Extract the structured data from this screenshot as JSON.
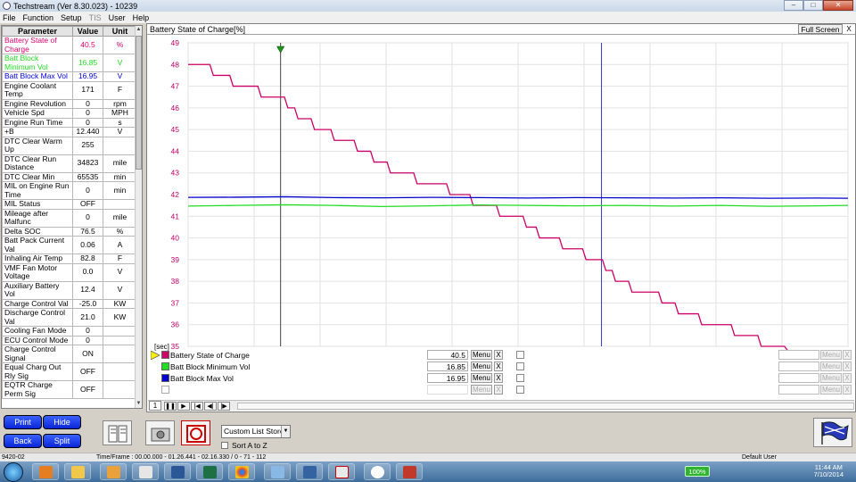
{
  "window": {
    "title": "Techstream (Ver 8.30.023) - 10239"
  },
  "menu": {
    "items": [
      "File",
      "Function",
      "Setup",
      "TIS",
      "User",
      "Help"
    ]
  },
  "params": {
    "headers": [
      "Parameter",
      "Value",
      "Unit"
    ],
    "rows": [
      {
        "name": "Battery State of Charge",
        "value": "40.5",
        "unit": "%",
        "color": "#e0006e",
        "h": 19
      },
      {
        "name": "Batt Block Minimum Vol",
        "value": "16.85",
        "unit": "V",
        "color": "#22dd22",
        "h": 19
      },
      {
        "name": "Batt Block Max Vol",
        "value": "16.95",
        "unit": "V",
        "color": "#0000dd",
        "h": 10
      },
      {
        "name": "Engine Coolant Temp",
        "value": "171",
        "unit": "F",
        "color": "#000",
        "h": 19
      },
      {
        "name": "Engine Revolution",
        "value": "0",
        "unit": "rpm",
        "color": "#000",
        "h": 10
      },
      {
        "name": "Vehicle Spd",
        "value": "0",
        "unit": "MPH",
        "color": "#000",
        "h": 10
      },
      {
        "name": "Engine Run Time",
        "value": "0",
        "unit": "s",
        "color": "#000",
        "h": 10
      },
      {
        "name": "+B",
        "value": "12.440",
        "unit": "V",
        "color": "#000",
        "h": 10
      },
      {
        "name": "DTC Clear Warm Up",
        "value": "255",
        "unit": "",
        "color": "#000",
        "h": 19
      },
      {
        "name": "DTC Clear Run Distance",
        "value": "34823",
        "unit": "mile",
        "color": "#000",
        "h": 19
      },
      {
        "name": "DTC Clear Min",
        "value": "65535",
        "unit": "min",
        "color": "#000",
        "h": 10
      },
      {
        "name": "MIL on Engine Run Time",
        "value": "0",
        "unit": "min",
        "color": "#000",
        "h": 19
      },
      {
        "name": "MIL Status",
        "value": "OFF",
        "unit": "",
        "color": "#000",
        "h": 10
      },
      {
        "name": "Mileage after Malfunc",
        "value": "0",
        "unit": "mile",
        "color": "#000",
        "h": 19
      },
      {
        "name": "Delta SOC",
        "value": "76.5",
        "unit": "%",
        "color": "#000",
        "h": 10
      },
      {
        "name": "Batt Pack Current Val",
        "value": "0.06",
        "unit": "A",
        "color": "#000",
        "h": 19
      },
      {
        "name": "Inhaling Air Temp",
        "value": "82.8",
        "unit": "F",
        "color": "#000",
        "h": 10
      },
      {
        "name": "VMF Fan Motor Voltage",
        "value": "0.0",
        "unit": "V",
        "color": "#000",
        "h": 19
      },
      {
        "name": "Auxiliary Battery Vol",
        "value": "12.4",
        "unit": "V",
        "color": "#000",
        "h": 19
      },
      {
        "name": "Charge Control Val",
        "value": "-25.0",
        "unit": "KW",
        "color": "#000",
        "h": 10
      },
      {
        "name": "Discharge Control Val",
        "value": "21.0",
        "unit": "KW",
        "color": "#000",
        "h": 19
      },
      {
        "name": "Cooling Fan Mode",
        "value": "0",
        "unit": "",
        "color": "#000",
        "h": 10
      },
      {
        "name": "ECU Control Mode",
        "value": "0",
        "unit": "",
        "color": "#000",
        "h": 10
      },
      {
        "name": "Charge Control Signal",
        "value": "ON",
        "unit": "",
        "color": "#000",
        "h": 19
      },
      {
        "name": "Equal Charg Out Rly Sig",
        "value": "OFF",
        "unit": "",
        "color": "#000",
        "h": 19
      },
      {
        "name": "EQTR Charge Perm Sig",
        "value": "OFF",
        "unit": "",
        "color": "#000",
        "h": 19
      }
    ]
  },
  "graph": {
    "title": "Battery State of Charge[%]",
    "fullscreen_label": "Full Screen",
    "close_label": "X",
    "x_unit_label": "[sec]",
    "legend": [
      {
        "name": "Battery State of Charge",
        "value": "40.5",
        "color": "#cc0066"
      },
      {
        "name": "Batt Block Minimum Vol",
        "value": "16.85",
        "color": "#22dd22"
      },
      {
        "name": "Batt Block Max Vol",
        "value": "16.95",
        "color": "#0000cc"
      }
    ],
    "menu_label": "Menu",
    "x_label": "X",
    "page_number": "1"
  },
  "chart_data": {
    "type": "line",
    "xlim": [
      0,
      136.33
    ],
    "ylim": [
      35,
      49
    ],
    "x_ticks": [
      0,
      13.633,
      27.266,
      40.899,
      54.532,
      68.165,
      81.798,
      95.431,
      109.064,
      122.697,
      136.33
    ],
    "y_ticks": [
      35,
      36,
      37,
      38,
      39,
      40,
      41,
      42,
      43,
      44,
      45,
      46,
      47,
      48,
      49
    ],
    "grid": true,
    "cursors": [
      19.1,
      85.4
    ],
    "series": [
      {
        "name": "Battery State of Charge",
        "color": "#cc0066",
        "x": [
          0,
          4.5,
          5.2,
          8.6,
          9.3,
          14.4,
          15.1,
          19.9,
          20.6,
          22.0,
          22.7,
          25.4,
          26.1,
          29.5,
          30.2,
          34.3,
          35.0,
          37.7,
          38.4,
          41.1,
          41.8,
          46.6,
          47.3,
          53.4,
          54.1,
          58.2,
          58.9,
          63.7,
          64.4,
          69.2,
          69.9,
          71.9,
          72.6,
          76.7,
          77.4,
          81.5,
          82.2,
          85.6,
          86.3,
          87.6,
          88.3,
          91.0,
          91.7,
          97.2,
          97.9,
          100.6,
          101.3,
          105.4,
          106.1,
          112.2,
          112.9,
          117.7,
          118.4,
          123.2,
          123.9,
          125.9,
          126.6,
          132.1,
          132.8,
          136.33
        ],
        "y": [
          48.0,
          48.0,
          47.5,
          47.5,
          47.0,
          47.0,
          46.5,
          46.5,
          46.0,
          46.0,
          45.5,
          45.5,
          45.0,
          45.0,
          44.5,
          44.5,
          44.0,
          44.0,
          43.5,
          43.5,
          43.0,
          43.0,
          42.5,
          42.5,
          42.0,
          42.0,
          41.5,
          41.5,
          41.0,
          41.0,
          40.5,
          40.5,
          40.0,
          40.0,
          39.5,
          39.5,
          39.0,
          39.0,
          38.5,
          38.5,
          38.0,
          38.0,
          37.5,
          37.5,
          37.0,
          37.0,
          36.5,
          36.5,
          36.0,
          36.0,
          35.5,
          35.5,
          35.0,
          35.0,
          34.5,
          34.5,
          34.0,
          34.0,
          33.5,
          33.5
        ]
      },
      {
        "name": "Batt Block Minimum Vol",
        "color": "#22dd22",
        "x": [
          0,
          10,
          20,
          30,
          40,
          50,
          60,
          70,
          80,
          90,
          100,
          110,
          120,
          130,
          136.33
        ],
        "y": [
          41.47,
          41.5,
          41.53,
          41.5,
          41.45,
          41.48,
          41.52,
          41.5,
          41.48,
          41.5,
          41.47,
          41.5,
          41.46,
          41.48,
          41.5
        ]
      },
      {
        "name": "Batt Block Max Vol",
        "color": "#0000cc",
        "x": [
          0,
          10,
          20,
          30,
          40,
          50,
          60,
          70,
          80,
          90,
          100,
          110,
          120,
          130,
          136.33
        ],
        "y": [
          41.87,
          41.88,
          41.9,
          41.86,
          41.85,
          41.87,
          41.86,
          41.84,
          41.86,
          41.85,
          41.84,
          41.85,
          41.83,
          41.84,
          41.83
        ]
      }
    ]
  },
  "toolbar": {
    "print_label": "Print",
    "hide_label": "Hide",
    "back_label": "Back",
    "split_label": "Split",
    "store_select": "Custom List Store",
    "sort_label": "Sort A to Z"
  },
  "status": {
    "left": "9420-02",
    "frames": "Time/Frame : 00.00.000 - 01.26.441 - 02.16.330 / 0 - 71 - 112",
    "user": "Default User"
  },
  "taskbar": {
    "battery": "100%",
    "time": "11:44 AM",
    "date": "7/10/2014"
  }
}
